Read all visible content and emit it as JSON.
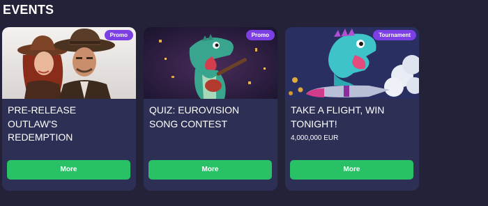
{
  "section": {
    "title": "EVENTS"
  },
  "cards": [
    {
      "badge": "Promo",
      "title_lines": [
        "PRE-RELEASE",
        "OUTLAW'S",
        "REDEMPTION"
      ],
      "amount": "",
      "button_label": "More",
      "image_subject": "cowboy-couple"
    },
    {
      "badge": "Promo",
      "title_lines": [
        "QUIZ: EUROVISION",
        "SONG CONTEST"
      ],
      "amount": "",
      "button_label": "More",
      "image_subject": "green-dinosaur-with-guitar"
    },
    {
      "badge": "Tournament",
      "title_lines": [
        "TAKE A FLIGHT, WIN",
        "TONIGHT!"
      ],
      "amount": "4,000,000 EUR",
      "button_label": "More",
      "image_subject": "dinosaur-on-rocket"
    }
  ],
  "colors": {
    "background": "#232239",
    "card": "#2e2f55",
    "badge": "#7b3fe4",
    "button": "#28c165",
    "text": "#ffffff"
  }
}
